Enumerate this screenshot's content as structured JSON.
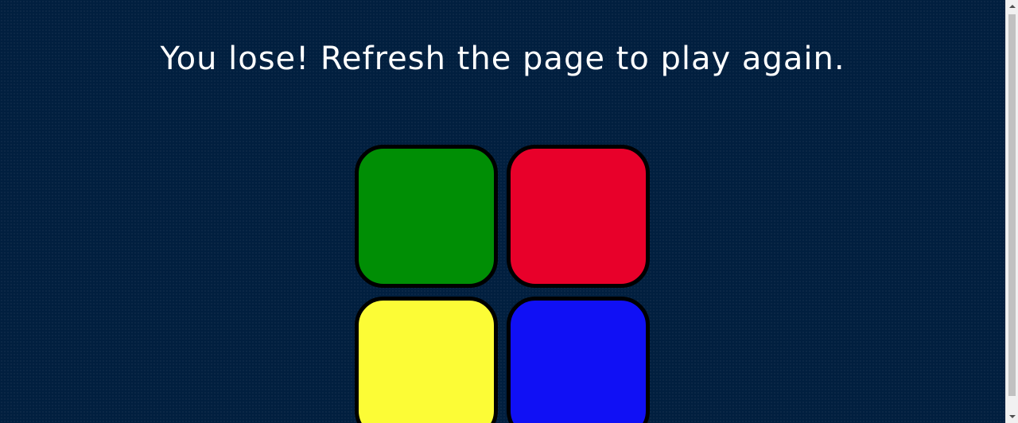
{
  "game": {
    "status_message": "You lose! Refresh the page to play again."
  },
  "buttons": [
    {
      "name": "green",
      "color": "#008E05"
    },
    {
      "name": "red",
      "color": "#E8002A"
    },
    {
      "name": "yellow",
      "color": "#FCFC36"
    },
    {
      "name": "blue",
      "color": "#1010F5"
    }
  ],
  "colors": {
    "background": "#011F3F",
    "title": "#FFFFFF",
    "button_border": "#000000"
  }
}
